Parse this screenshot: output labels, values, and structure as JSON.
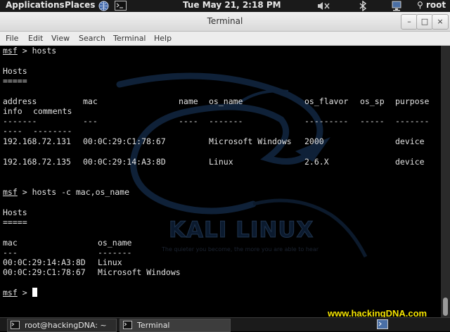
{
  "top_panel": {
    "applications": "Applications",
    "places": "Places",
    "icons": [
      "globe-icon",
      "terminal-icon",
      "volume-icon",
      "bluetooth-icon",
      "network-icon",
      "user-icon"
    ],
    "clock": "Tue May 21,  2:18 PM",
    "user": "root"
  },
  "window": {
    "title": "Terminal",
    "controls": {
      "minimize": "–",
      "maximize": "□",
      "close": "×"
    },
    "menu": {
      "file": "File",
      "edit": "Edit",
      "view": "View",
      "search": "Search",
      "terminal": "Terminal",
      "help": "Help"
    }
  },
  "terminal": {
    "prompt_name": "msf",
    "prompt_sep": " > ",
    "cmd1": "hosts",
    "hosts_heading": "Hosts",
    "hosts_rule": "=====",
    "table1": {
      "headers": [
        "address",
        "mac",
        "name",
        "os_name",
        "os_flavor",
        "os_sp",
        "purpose",
        "info",
        "comments"
      ],
      "dashes": [
        "-------",
        "---",
        "----",
        "-------",
        "---------",
        "-----",
        "-------",
        "----",
        "--------"
      ],
      "rows": [
        {
          "address": "192.168.72.131",
          "mac": "00:0C:29:C1:78:67",
          "name": "",
          "os_name": "Microsoft Windows",
          "os_flavor": "2000",
          "os_sp": "",
          "purpose": "device"
        },
        {
          "address": "192.168.72.135",
          "mac": "00:0C:29:14:A3:8D",
          "name": "",
          "os_name": "Linux",
          "os_flavor": "2.6.X",
          "os_sp": "",
          "purpose": "device"
        }
      ]
    },
    "cmd2": "hosts -c mac,os_name",
    "table2": {
      "headers": [
        "mac",
        "os_name"
      ],
      "dashes": [
        "---",
        "-------"
      ],
      "rows": [
        {
          "mac": "00:0C:29:14:A3:8D",
          "os_name": "Linux"
        },
        {
          "mac": "00:0C:29:C1:78:67",
          "os_name": "Microsoft Windows"
        }
      ]
    },
    "wallpaper_brand": "KALI LINUX",
    "wallpaper_tagline": "The quieter you become, the more you are able to hear"
  },
  "watermark": "www.hackingDNA.com",
  "taskbar": {
    "task1": "root@hackingDNA: ~",
    "task2": "Terminal"
  },
  "colors": {
    "terminal_bg": "#000000",
    "terminal_fg": "#e2e2e2",
    "watermark": "#f5e400",
    "panel_bg": "#1a1a1a"
  }
}
